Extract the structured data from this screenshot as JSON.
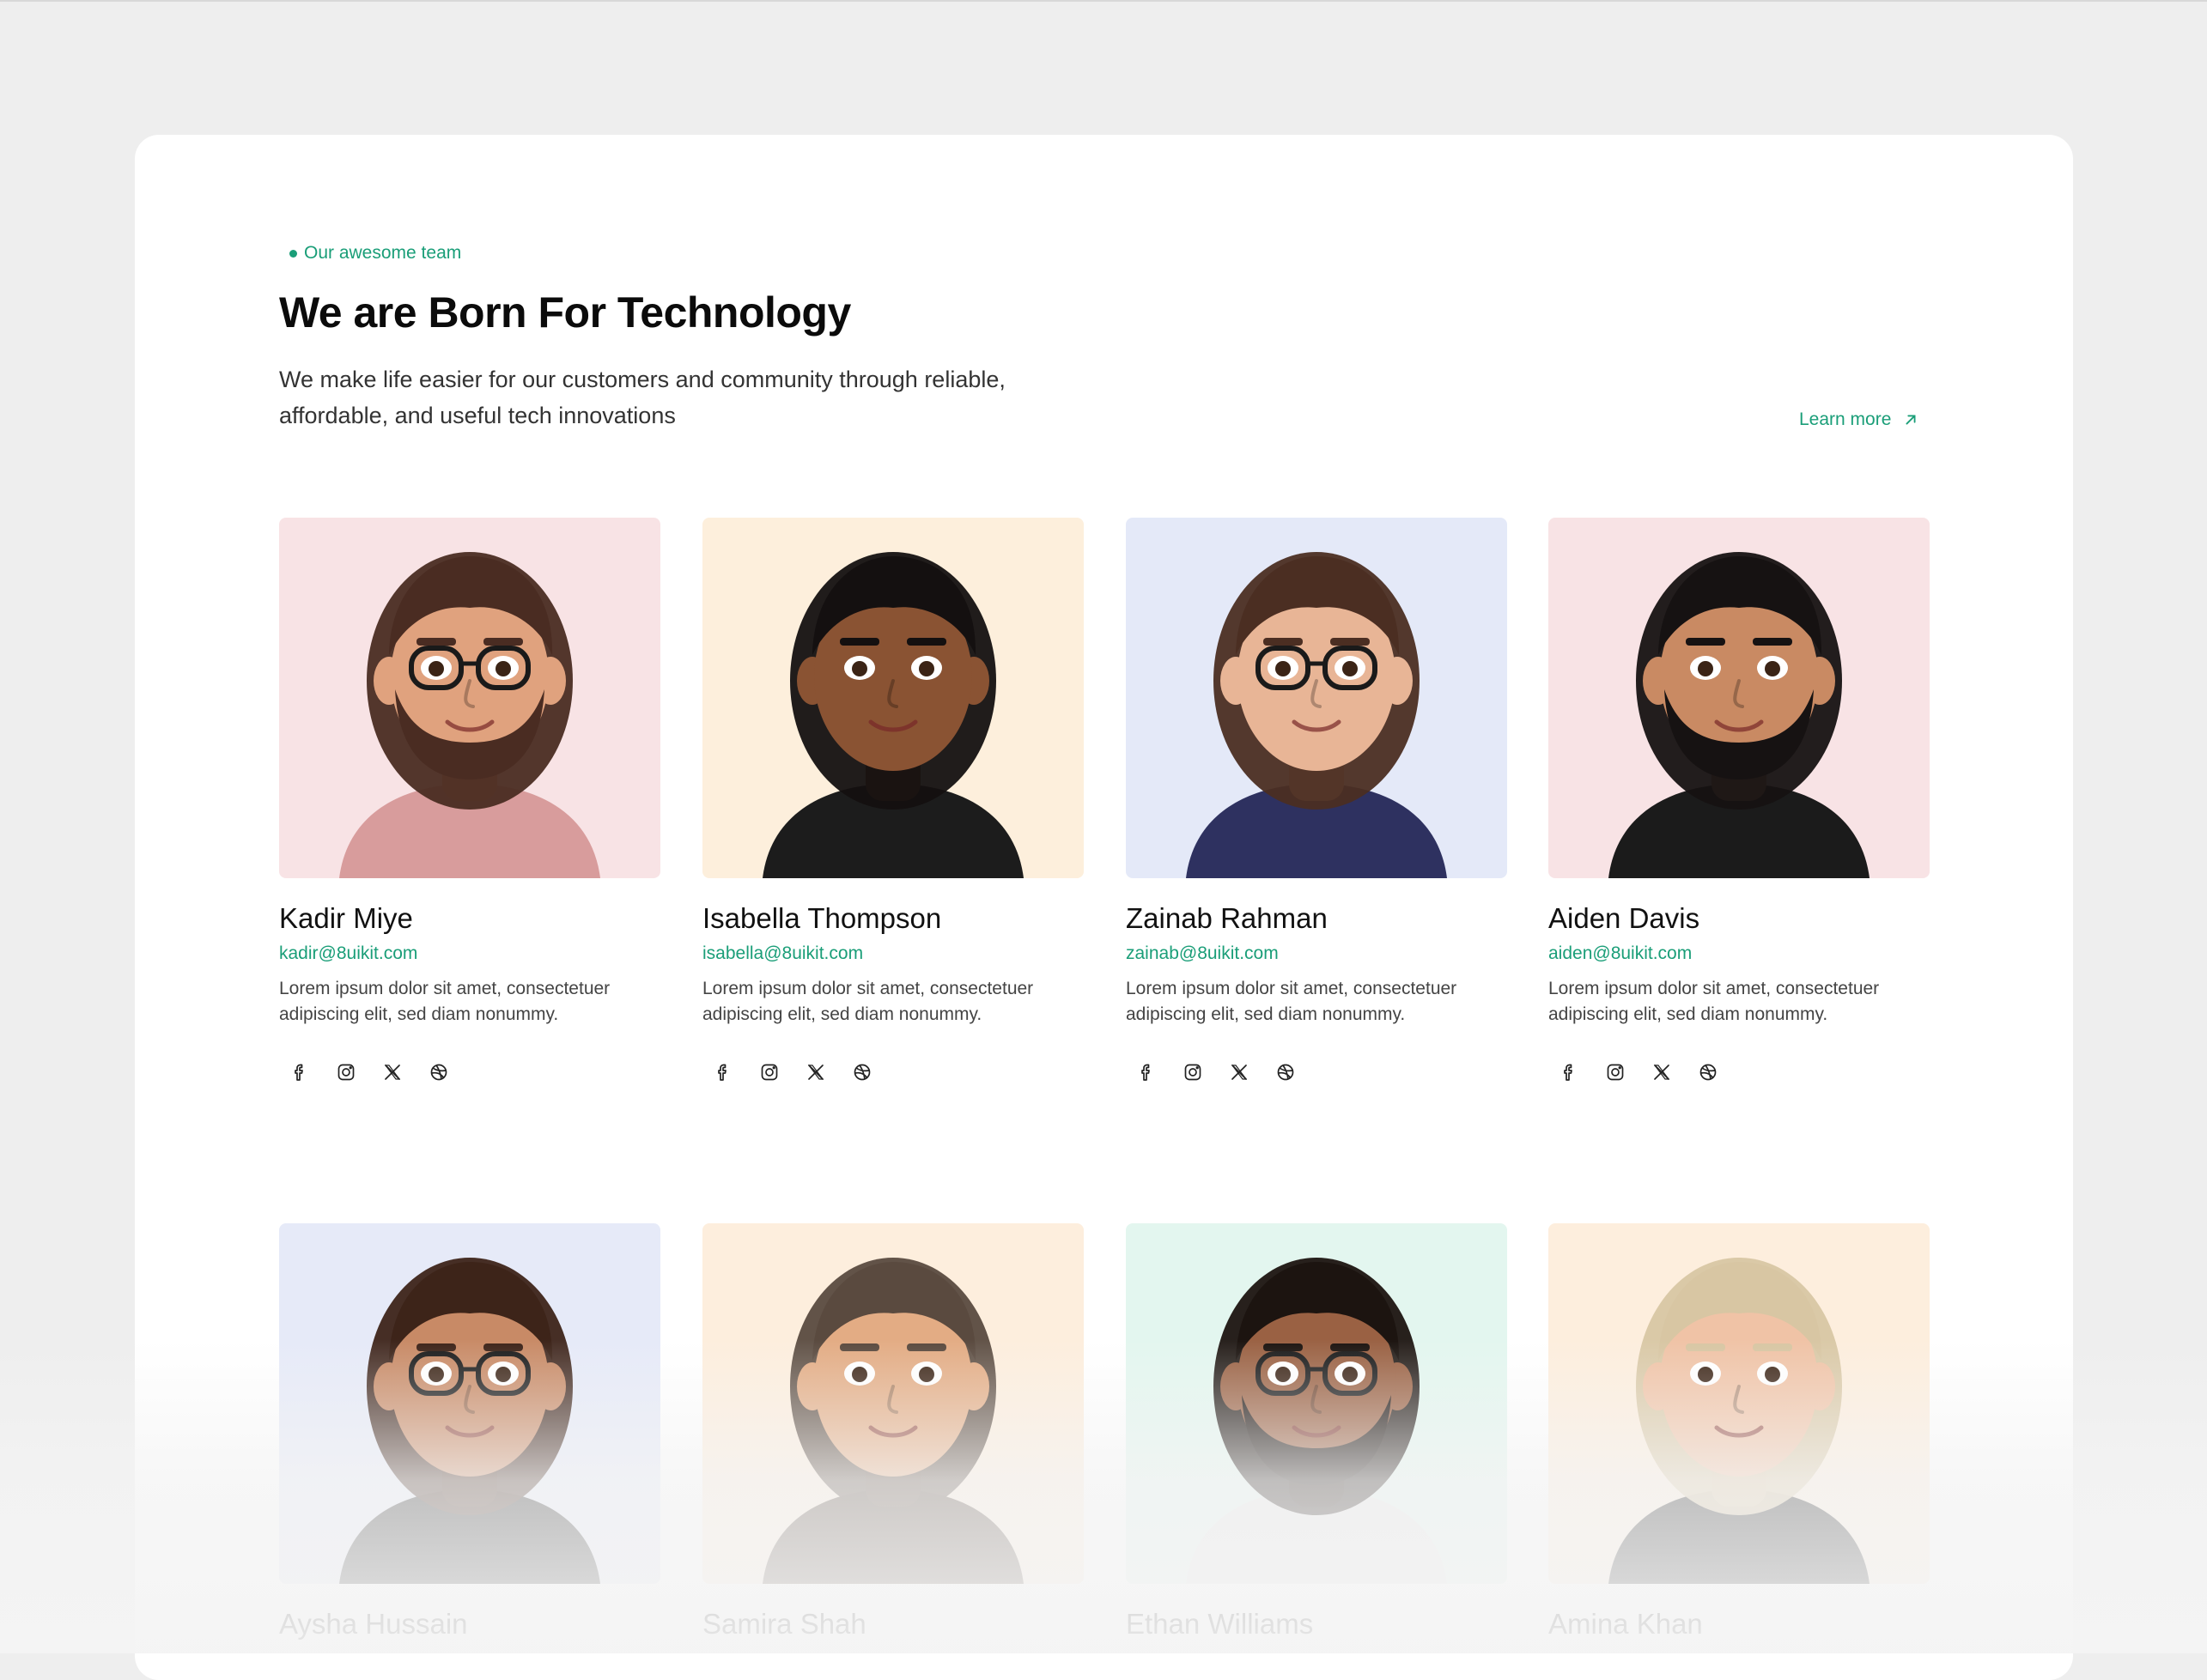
{
  "section": {
    "eyebrow": "Our awesome team",
    "title": "We are Born For Technology",
    "subtitle": "We make life easier for our customers and community through reliable, affordable, and useful tech innovations",
    "learn_more": "Learn more"
  },
  "colors": {
    "accent": "#1a9e78",
    "page_bg": "#eeeeee",
    "card_bg": "#ffffff"
  },
  "team": [
    {
      "name": "Kadir Miye",
      "email": "kadir@8uikit.com",
      "bio": "Lorem ipsum dolor sit amet, consectetuer adipiscing elit, sed diam nonummy.",
      "bg": "#f8e3e5",
      "skin": "#e0a27e",
      "hair": "#4a2c22",
      "shirt": "#d89c9c",
      "glasses": true,
      "beard": true,
      "socials": [
        "facebook-icon",
        "instagram-icon",
        "x-icon",
        "dribbble-icon"
      ]
    },
    {
      "name": "Isabella Thompson",
      "email": "isabella@8uikit.com",
      "bio": "Lorem ipsum dolor sit amet, consectetuer adipiscing elit, sed diam nonummy.",
      "bg": "#fdefdc",
      "skin": "#8a5333",
      "hair": "#141010",
      "shirt": "#1c1c1c",
      "glasses": false,
      "beard": false,
      "socials": [
        "facebook-icon",
        "instagram-icon",
        "x-icon",
        "dribbble-icon"
      ]
    },
    {
      "name": "Zainab Rahman",
      "email": "zainab@8uikit.com",
      "bio": "Lorem ipsum dolor sit amet, consectetuer adipiscing elit, sed diam nonummy.",
      "bg": "#e4e9f8",
      "skin": "#e8b596",
      "hair": "#4b2e22",
      "shirt": "#2e3160",
      "glasses": true,
      "beard": false,
      "socials": [
        "facebook-icon",
        "instagram-icon",
        "x-icon",
        "dribbble-icon"
      ]
    },
    {
      "name": "Aiden Davis",
      "email": "aiden@8uikit.com",
      "bio": "Lorem ipsum dolor sit amet, consectetuer adipiscing elit, sed diam nonummy.",
      "bg": "#f8e3e5",
      "skin": "#c98a63",
      "hair": "#161212",
      "shirt": "#1b1b1b",
      "glasses": false,
      "beard": true,
      "socials": [
        "facebook-icon",
        "instagram-icon",
        "x-icon",
        "dribbble-icon"
      ]
    },
    {
      "name": "Aysha Hussain",
      "bg": "#e6eaf8",
      "skin": "#c88a66",
      "hair": "#3d2419",
      "shirt": "#222222",
      "glasses": true,
      "beard": false
    },
    {
      "name": "Samira Shah",
      "bg": "#fdeedd",
      "skin": "#e3ac84",
      "hair": "#5a4a3f",
      "shirt": "#5a4a3f",
      "glasses": false,
      "beard": false
    },
    {
      "name": "Ethan Williams",
      "bg": "#e3f6ef",
      "skin": "#9a6143",
      "hair": "#1c1410",
      "shirt": "#e6e6e6",
      "glasses": true,
      "beard": true
    },
    {
      "name": "Amina Khan",
      "bg": "#fdeedd",
      "skin": "#f0c3a6",
      "hair": "#d8c6a3",
      "shirt": "#1f1f1f",
      "glasses": false,
      "beard": false
    }
  ]
}
